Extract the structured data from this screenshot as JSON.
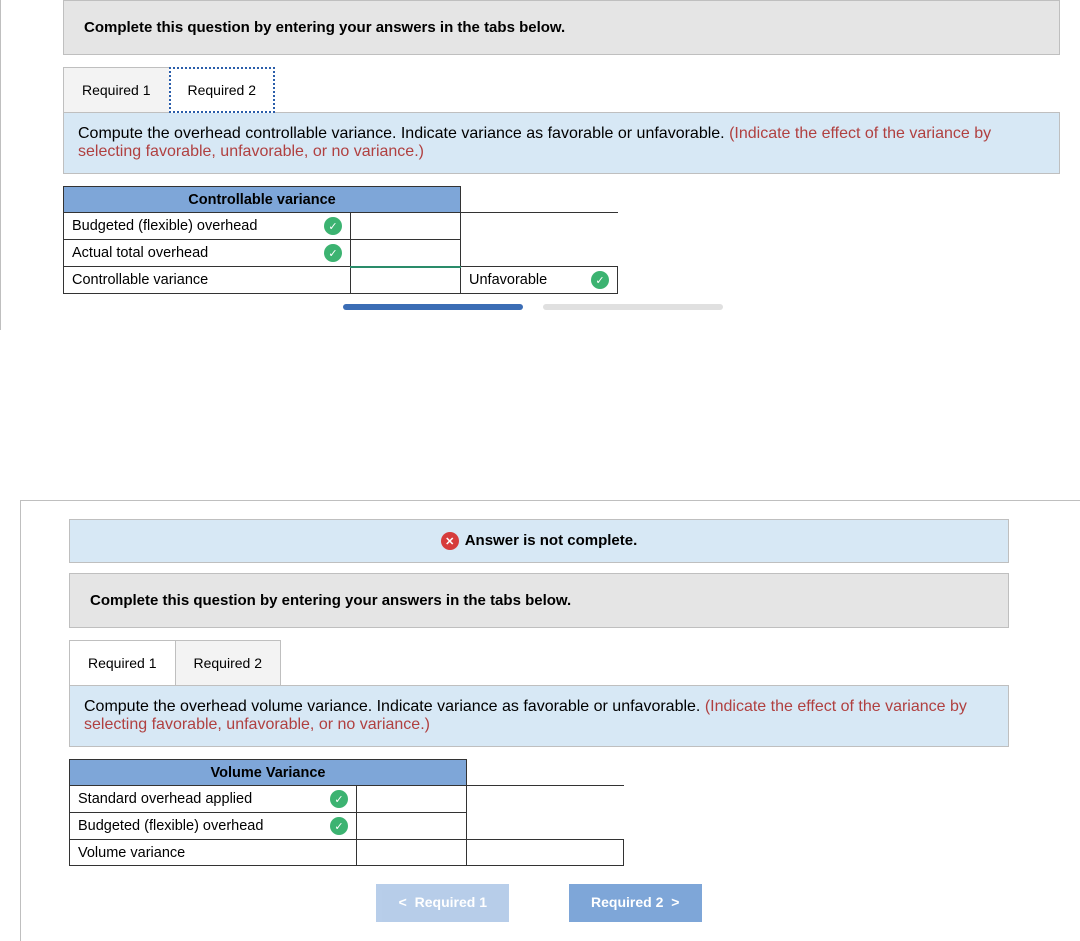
{
  "section1": {
    "banner": "Complete this question by entering your answers in the tabs below.",
    "tabs": {
      "t1": "Required 1",
      "t2": "Required 2"
    },
    "prompt_main": "Compute the overhead controllable variance. Indicate variance as favorable or unfavorable. ",
    "prompt_hint": "(Indicate the effect of the variance by selecting favorable, unfavorable, or no variance.)",
    "table": {
      "header": "Controllable variance",
      "rows": {
        "r1": "Budgeted (flexible) overhead",
        "r2": "Actual total overhead",
        "r3": "Controllable variance"
      },
      "select_value": "Unfavorable"
    }
  },
  "section2": {
    "status": "Answer is not complete.",
    "banner": "Complete this question by entering your answers in the tabs below.",
    "tabs": {
      "t1": "Required 1",
      "t2": "Required 2"
    },
    "prompt_main": "Compute the overhead volume variance. Indicate variance as favorable or unfavorable. ",
    "prompt_hint": "(Indicate the effect of the variance by selecting favorable, unfavorable, or no variance.)",
    "table": {
      "header": "Volume Variance",
      "rows": {
        "r1": "Standard overhead applied",
        "r2": "Budgeted (flexible) overhead",
        "r3": "Volume variance"
      }
    },
    "nav": {
      "prev": "Required 1",
      "next": "Required 2"
    }
  }
}
